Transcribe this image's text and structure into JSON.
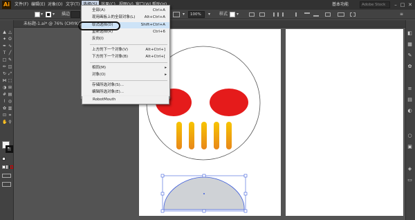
{
  "app": {
    "logo": "Ai",
    "menus": [
      "文件(F)",
      "编辑(E)",
      "对象(O)",
      "文字(T)",
      "选择(S)",
      "效果(C)",
      "视图(V)",
      "窗口(W)",
      "帮助(H)"
    ],
    "workspace": "基本功能",
    "search_placeholder": "Adobe Stock"
  },
  "control_bar": {
    "stroke_label": "描边",
    "zoom_value": "100%",
    "style_label": "样式"
  },
  "document_tab": {
    "title": "未标题-1.ai* @ 76% (CMYK/预览)"
  },
  "select_menu": {
    "items": [
      {
        "label": "全部(A)",
        "shortcut": "Ctrl+A"
      },
      {
        "label": "现用画板上的全部对象(L)",
        "shortcut": "Alt+Ctrl+A"
      },
      {
        "label": "取消选择(D)",
        "shortcut": "Shift+Ctrl+A"
      },
      {
        "label": "重新选择(R)",
        "shortcut": "Ctrl+6"
      },
      {
        "label": "反向(I)",
        "shortcut": ""
      },
      {
        "label": "上方的下一个对象(V)",
        "shortcut": "Alt+Ctrl+]"
      },
      {
        "label": "下方的下一个对象(B)",
        "shortcut": "Alt+Ctrl+["
      },
      {
        "label": "相同(M)",
        "shortcut": "",
        "submenu": true
      },
      {
        "label": "对象(O)",
        "shortcut": "",
        "submenu": true
      },
      {
        "label": "存储所选对象(S)...",
        "shortcut": ""
      },
      {
        "label": "编辑所选对象(E)...",
        "shortcut": ""
      },
      {
        "label": "RobotMouth",
        "shortcut": ""
      }
    ],
    "highlighted_index": 2
  },
  "colors": {
    "eye_red": "#e51b1b",
    "tooth_gold": "#f5a623",
    "mouth_gray": "#cfd2d6",
    "selection_blue": "#3b5bdb"
  },
  "icons": {
    "submenu_arrow": "▸",
    "dropdown_caret": "▾"
  }
}
